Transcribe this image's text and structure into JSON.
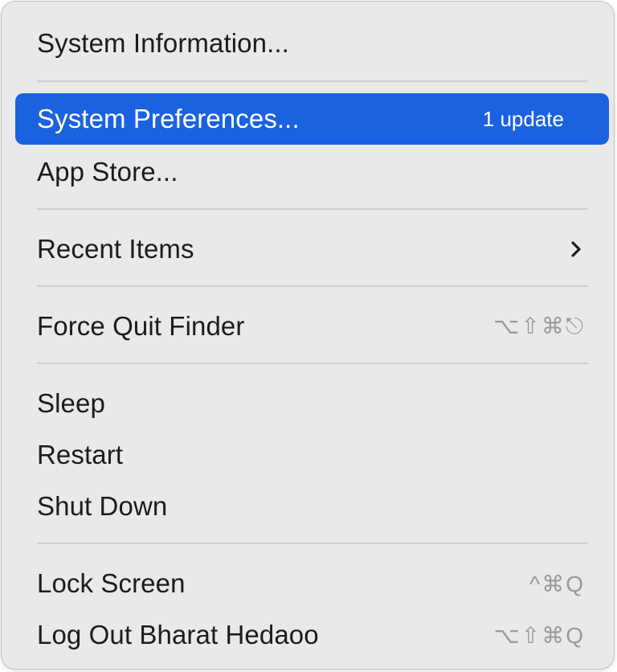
{
  "menu": {
    "items": [
      {
        "label": "System Information..."
      },
      {
        "label": "System Preferences...",
        "badge": "1 update",
        "selected": true
      },
      {
        "label": "App Store..."
      },
      {
        "label": "Recent Items",
        "submenu_icon": "chevron-right-icon"
      },
      {
        "label": "Force Quit Finder",
        "shortcut": "⌥⇧⌘⎋"
      },
      {
        "label": "Sleep"
      },
      {
        "label": "Restart"
      },
      {
        "label": "Shut Down"
      },
      {
        "label": "Lock Screen",
        "shortcut": "^⌘Q"
      },
      {
        "label": "Log Out Bharat Hedaoo",
        "shortcut": "⌥⇧⌘Q"
      }
    ]
  },
  "colors": {
    "selection": "#1a62e0",
    "menu_background": "#e9e9e9",
    "shortcut_text": "#9a9a9a"
  }
}
